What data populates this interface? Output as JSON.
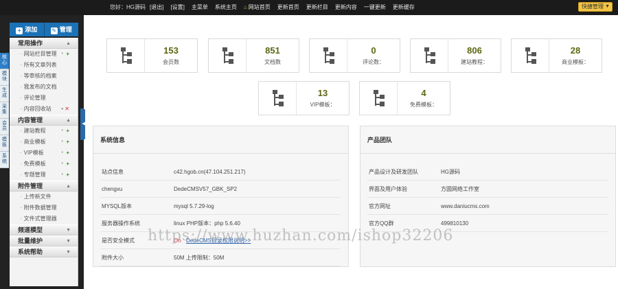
{
  "topbar": {
    "welcome": "您好：HG源码",
    "nav": [
      {
        "label": "[退出]",
        "green": false
      },
      {
        "label": "[设置]",
        "green": false
      },
      {
        "label": "主菜单",
        "green": true
      },
      {
        "label": "系统主页",
        "green": true
      },
      {
        "label": "网站首页",
        "green": true,
        "icon": "home-icon"
      },
      {
        "label": "更新首页",
        "green": false
      },
      {
        "label": "更新栏目",
        "green": false
      },
      {
        "label": "更新内容",
        "green": false
      },
      {
        "label": "一键更新",
        "green": false
      },
      {
        "label": "更新缓存",
        "green": false
      }
    ],
    "quick_button": "快捷管理"
  },
  "vtabs": [
    "核心",
    "模块",
    "生成",
    "采集",
    "会员",
    "模板",
    "系统"
  ],
  "actions": {
    "add": "添加",
    "manage": "管理"
  },
  "menu": [
    {
      "title": "常用操作",
      "items": [
        {
          "label": "网站栏目管理",
          "mark": "plus"
        },
        {
          "label": "所有文章列表"
        },
        {
          "label": "等审核的档案"
        },
        {
          "label": "我发布的文档"
        },
        {
          "label": "评论管理"
        },
        {
          "label": "内容回收站",
          "mark": "x"
        }
      ]
    },
    {
      "title": "内容管理",
      "items": [
        {
          "label": "建站教程",
          "mark": "plus"
        },
        {
          "label": "商业模板",
          "mark": "plus"
        },
        {
          "label": "VIP模板",
          "mark": "plus"
        },
        {
          "label": "免费模板",
          "mark": "plus"
        },
        {
          "label": "专题管理",
          "mark": "plus"
        }
      ]
    },
    {
      "title": "附件管理",
      "items": [
        {
          "label": "上传新文件"
        },
        {
          "label": "附件数据管理"
        },
        {
          "label": "文件式管理器"
        }
      ]
    },
    {
      "title": "频道模型",
      "items": []
    },
    {
      "title": "批量维护",
      "items": []
    },
    {
      "title": "系统帮助",
      "items": []
    }
  ],
  "stats": [
    {
      "value": "153",
      "label": "会员数"
    },
    {
      "value": "851",
      "label": "文档数"
    },
    {
      "value": "0",
      "label": "评论数："
    },
    {
      "value": "806",
      "label": "建站教程："
    },
    {
      "value": "28",
      "label": "商业模板："
    },
    {
      "value": "13",
      "label": "VIP模板："
    },
    {
      "value": "4",
      "label": "免费模板："
    }
  ],
  "system_info": {
    "title": "系统信息",
    "rows": [
      {
        "key": "站点信息",
        "value": "c42.hgob.cn(47.104.251.217)"
      },
      {
        "key": "chengxu",
        "value": "DedeCMSV57_GBK_SP2"
      },
      {
        "key": "MYSQL版本",
        "value": "mysql 5.7.29-log"
      },
      {
        "key": "服务器操作系统",
        "value": "linux PHP版本：php 5.6.40"
      },
      {
        "key": "是否安全模式",
        "value": "On",
        "link": "DedeCMS目录权限说明>>"
      },
      {
        "key": "附件大小",
        "value": "50M 上传限制：50M"
      }
    ]
  },
  "team": {
    "title": "产品团队",
    "rows": [
      {
        "key": "产品设计及研发团队",
        "value": "HG源码"
      },
      {
        "key": "界面及用户体验",
        "value": "方圆网络工作室"
      },
      {
        "key": "官方网址",
        "value": "www.daniucms.com"
      },
      {
        "key": "官方QQ群",
        "value": "499810130"
      }
    ]
  },
  "watermark": "https://www.huzhan.com/ishop32206",
  "colors": {
    "topbar": "#1b1b1b",
    "accent": "#1b72b6",
    "stat_number": "#5d6612",
    "green_nav": "#9cd23a"
  }
}
